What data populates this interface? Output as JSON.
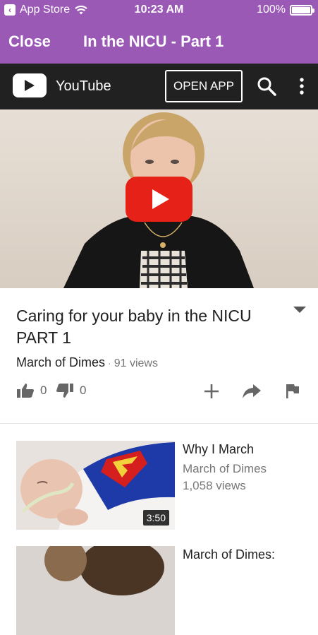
{
  "status_bar": {
    "back_app": "App Store",
    "time": "10:23 AM",
    "battery": "100%"
  },
  "nav": {
    "close_label": "Close",
    "title": "In the NICU - Part 1"
  },
  "youtube_bar": {
    "brand": "YouTube",
    "open_app_label": "OPEN APP"
  },
  "video": {
    "title": "Caring for your baby in the NICU PART 1",
    "channel": "March of Dimes",
    "views": "91 views",
    "likes": "0",
    "dislikes": "0"
  },
  "related": [
    {
      "title": "Why I March",
      "channel": "March of Dimes",
      "views": "1,058 views",
      "duration": "3:50"
    },
    {
      "title": "March of Dimes:",
      "channel": "",
      "views": "",
      "duration": ""
    }
  ],
  "colors": {
    "accent": "#9b59b6",
    "youtube_dark": "#212121",
    "youtube_red": "#e62117"
  }
}
